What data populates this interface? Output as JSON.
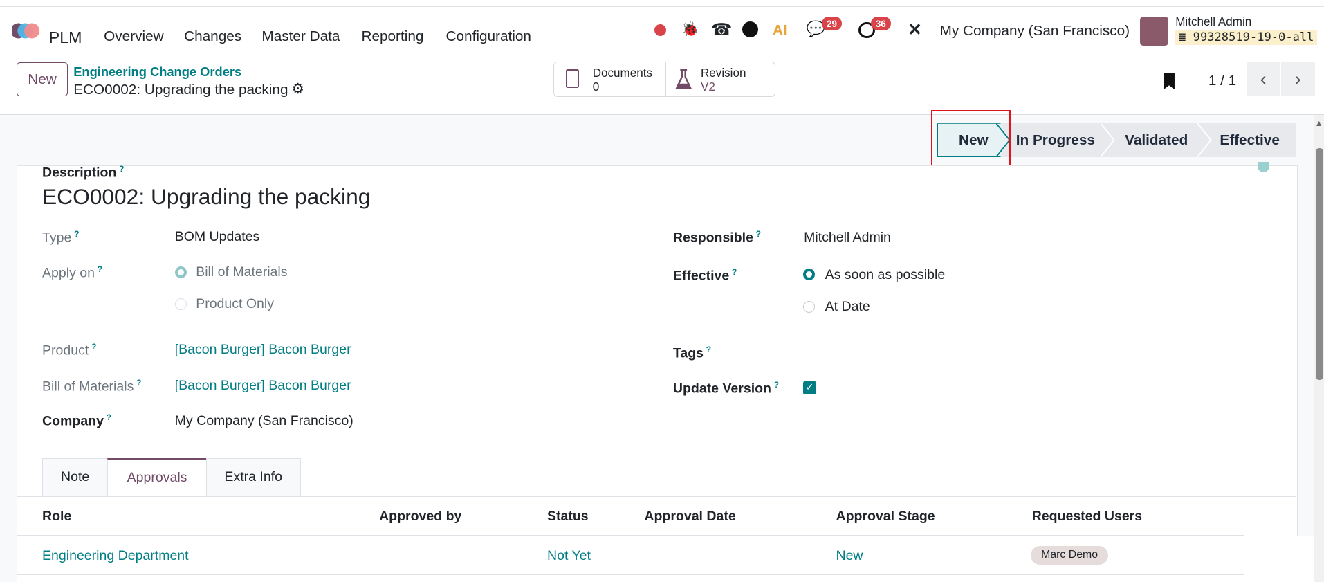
{
  "navbar": {
    "app": "PLM",
    "menus": [
      "Overview",
      "Changes",
      "Master Data",
      "Reporting",
      "Configuration"
    ],
    "messages_count": "29",
    "activities_count": "36",
    "company": "My Company (San Francisco)",
    "user": "Mitchell Admin",
    "database": "99328519-19-0-all",
    "ai_label": "AI"
  },
  "control_panel": {
    "new_button": "New",
    "breadcrumb_parent": "Engineering Change Orders",
    "breadcrumb_current": "ECO0002: Upgrading the packing",
    "documents_label": "Documents",
    "documents_count": "0",
    "revision_label": "Revision",
    "revision_value": "V2",
    "pager": "1 / 1"
  },
  "stages": [
    "New",
    "In Progress",
    "Validated",
    "Effective"
  ],
  "form": {
    "description_label": "Description",
    "title": "ECO0002: Upgrading the packing",
    "help": "?",
    "type_label": "Type",
    "type_value": "BOM Updates",
    "apply_on_label": "Apply on",
    "apply_on_options": [
      "Bill of Materials",
      "Product Only"
    ],
    "product_label": "Product",
    "product_value": "[Bacon Burger] Bacon Burger",
    "bom_label": "Bill of Materials",
    "bom_value": "[Bacon Burger] Bacon Burger",
    "company_label": "Company",
    "company_value": "My Company (San Francisco)",
    "responsible_label": "Responsible",
    "responsible_value": "Mitchell Admin",
    "effective_label": "Effective",
    "effective_options": [
      "As soon as possible",
      "At Date"
    ],
    "tags_label": "Tags",
    "update_version_label": "Update Version",
    "update_version_checked": true
  },
  "tabs": [
    "Note",
    "Approvals",
    "Extra Info"
  ],
  "approvals": {
    "headers": [
      "Role",
      "Approved by",
      "Status",
      "Approval Date",
      "Approval Stage",
      "Requested Users"
    ],
    "rows": [
      {
        "role": "Engineering Department",
        "approved_by": "",
        "status": "Not Yet",
        "date": "",
        "stage": "New",
        "users": "Marc Demo"
      }
    ]
  },
  "colors": {
    "primary": "#714b67",
    "link": "#017e84"
  }
}
